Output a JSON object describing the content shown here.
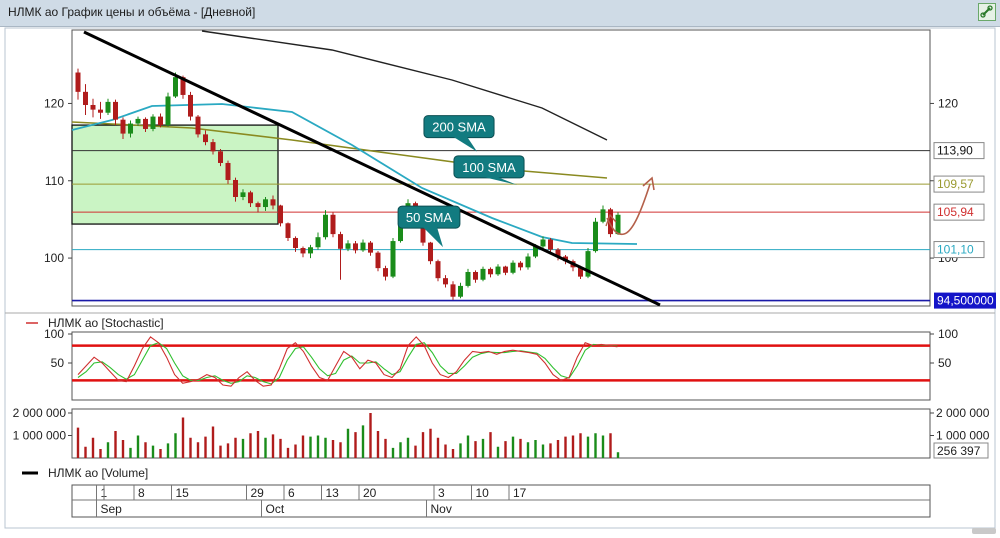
{
  "window": {
    "title": "НЛМК ао График цены и объёма - [Дневной]"
  },
  "colors": {
    "up": "#1a8c1a",
    "down": "#b01c1c",
    "sma50": "#2aa9c2",
    "sma100": "#8a8a20",
    "sma200": "#222222",
    "trend": "#000000",
    "support": "#1a1aa8",
    "resistance": "#d03030",
    "box": "#b8f0b0",
    "callout": "#127b80",
    "arrow": "#b4604a",
    "stoch_k": "#d03030",
    "stoch_d": "#30c030",
    "stoch_band": "#e01010"
  },
  "chart_data": [
    {
      "type": "candlestick",
      "title": "",
      "y_ticks": [
        "120",
        "110",
        "100"
      ],
      "ylim": [
        93.8,
        129.5
      ],
      "price_levels": [
        {
          "label": "113,90",
          "value": 113.9,
          "color": "#333333"
        },
        {
          "label": "109,57",
          "value": 109.57,
          "color": "#9a9a30"
        },
        {
          "label": "105,94",
          "value": 105.94,
          "color": "#d03030"
        },
        {
          "label": "101,10",
          "value": 101.1,
          "color": "#2aa9c2"
        },
        {
          "label": "94,500000",
          "value": 94.5,
          "color": "#1a1aa8",
          "highlight": true
        }
      ],
      "annotations": [
        {
          "text": "200 SMA",
          "x": 50,
          "y": 117
        },
        {
          "text": "100 SMA",
          "x": 54,
          "y": 111.8
        },
        {
          "text": "50 SMA",
          "x": 46,
          "y": 105.3
        }
      ],
      "candles": [
        [
          124,
          124.5,
          120.5,
          121.5
        ],
        [
          121.5,
          122.5,
          118.5,
          119.8
        ],
        [
          119.8,
          120.6,
          118.2,
          119.2
        ],
        [
          119.2,
          120.2,
          118.0,
          118.8
        ],
        [
          118.8,
          120.6,
          118.5,
          120.2
        ],
        [
          120.2,
          120.5,
          117.2,
          117.9
        ],
        [
          117.9,
          118.2,
          115.4,
          116.1
        ],
        [
          116.1,
          117.8,
          115.6,
          117.4
        ],
        [
          117.4,
          118.3,
          117.1,
          118.0
        ],
        [
          118.0,
          118.2,
          116.3,
          116.7
        ],
        [
          116.7,
          118.6,
          116.4,
          118.3
        ],
        [
          118.3,
          118.7,
          116.9,
          117.2
        ],
        [
          117.2,
          121.4,
          117.0,
          120.9
        ],
        [
          120.9,
          124.0,
          120.7,
          123.4
        ],
        [
          123.4,
          123.6,
          120.6,
          121.1
        ],
        [
          121.1,
          121.5,
          117.8,
          118.3
        ],
        [
          118.3,
          118.5,
          115.6,
          116.0
        ],
        [
          116.0,
          116.5,
          114.6,
          115.0
        ],
        [
          115.0,
          115.4,
          113.4,
          113.8
        ],
        [
          113.8,
          114.1,
          111.9,
          112.3
        ],
        [
          112.3,
          112.6,
          109.6,
          110.1
        ],
        [
          110.1,
          110.4,
          107.3,
          107.9
        ],
        [
          107.9,
          108.9,
          107.5,
          108.5
        ],
        [
          108.5,
          108.7,
          106.6,
          107.1
        ],
        [
          107.1,
          107.3,
          105.9,
          106.6
        ],
        [
          106.6,
          107.9,
          106.1,
          107.6
        ],
        [
          107.6,
          108.1,
          106.3,
          106.8
        ],
        [
          106.8,
          106.9,
          104.1,
          104.5
        ],
        [
          104.5,
          104.6,
          102.2,
          102.6
        ],
        [
          102.6,
          102.8,
          100.8,
          101.3
        ],
        [
          101.3,
          101.5,
          100.1,
          100.6
        ],
        [
          100.6,
          101.7,
          100.0,
          101.4
        ],
        [
          101.4,
          103.3,
          101.1,
          102.7
        ],
        [
          102.7,
          106.2,
          102.4,
          105.6
        ],
        [
          105.6,
          105.9,
          102.7,
          103.1
        ],
        [
          103.1,
          103.4,
          97.2,
          101.2
        ],
        [
          101.2,
          102.3,
          100.9,
          101.9
        ],
        [
          101.9,
          102.2,
          100.6,
          101.0
        ],
        [
          101.0,
          102.4,
          100.8,
          102.0
        ],
        [
          102.0,
          102.2,
          100.3,
          100.7
        ],
        [
          100.7,
          100.9,
          98.3,
          98.7
        ],
        [
          98.7,
          99.0,
          97.1,
          97.6
        ],
        [
          97.6,
          102.6,
          97.4,
          102.2
        ],
        [
          102.2,
          106.3,
          102.0,
          105.8
        ],
        [
          105.8,
          107.6,
          105.6,
          107.1
        ],
        [
          107.1,
          107.3,
          105.4,
          105.8
        ],
        [
          105.8,
          105.9,
          101.6,
          102.0
        ],
        [
          102.0,
          102.1,
          99.2,
          99.6
        ],
        [
          99.6,
          99.8,
          97.0,
          97.4
        ],
        [
          97.4,
          97.8,
          96.2,
          96.6
        ],
        [
          96.6,
          97.0,
          94.6,
          95.0
        ],
        [
          95.0,
          96.8,
          94.8,
          96.4
        ],
        [
          96.4,
          98.6,
          96.2,
          98.2
        ],
        [
          98.2,
          98.4,
          96.8,
          97.2
        ],
        [
          97.2,
          98.9,
          97.0,
          98.6
        ],
        [
          98.6,
          98.8,
          97.5,
          97.9
        ],
        [
          97.9,
          99.2,
          97.7,
          98.9
        ],
        [
          98.9,
          99.0,
          97.8,
          98.1
        ],
        [
          98.1,
          99.7,
          97.9,
          99.4
        ],
        [
          99.4,
          99.6,
          98.4,
          98.8
        ],
        [
          98.8,
          100.6,
          98.5,
          100.2
        ],
        [
          100.2,
          101.8,
          100.0,
          101.5
        ],
        [
          101.5,
          102.8,
          101.3,
          102.4
        ],
        [
          102.4,
          102.6,
          100.6,
          101.1
        ],
        [
          101.1,
          101.3,
          99.7,
          100.2
        ],
        [
          100.2,
          100.4,
          99.2,
          99.6
        ],
        [
          99.6,
          99.8,
          98.3,
          98.8
        ],
        [
          98.8,
          99.0,
          97.3,
          97.6
        ],
        [
          97.6,
          101.3,
          97.4,
          100.9
        ],
        [
          100.9,
          105.2,
          100.7,
          104.7
        ],
        [
          104.7,
          106.8,
          104.5,
          106.3
        ],
        [
          106.3,
          106.5,
          102.7,
          103.1
        ],
        [
          103.1,
          105.9,
          103.0,
          105.6
        ]
      ]
    },
    {
      "type": "line",
      "title": "НЛМК ао [Stochastic]",
      "series_label": "НЛМК ао [Stochastic]",
      "y_ticks": [
        "100",
        "50"
      ],
      "ylim": [
        0,
        100
      ],
      "bands": [
        80,
        20
      ],
      "k": [
        30,
        45,
        60,
        50,
        35,
        20,
        18,
        45,
        75,
        95,
        85,
        60,
        30,
        15,
        18,
        22,
        30,
        25,
        12,
        10,
        25,
        35,
        20,
        10,
        12,
        40,
        75,
        85,
        70,
        45,
        25,
        20,
        45,
        70,
        60,
        40,
        55,
        50,
        30,
        25,
        40,
        80,
        95,
        80,
        50,
        30,
        25,
        35,
        55,
        70,
        68,
        70,
        65,
        70,
        72,
        70,
        68,
        65,
        50,
        30,
        20,
        25,
        60,
        85,
        80,
        82,
        80,
        78
      ],
      "d": [
        25,
        35,
        50,
        52,
        42,
        30,
        22,
        30,
        55,
        80,
        85,
        75,
        50,
        28,
        20,
        20,
        25,
        28,
        20,
        15,
        18,
        28,
        25,
        18,
        14,
        25,
        55,
        75,
        78,
        60,
        40,
        28,
        32,
        55,
        62,
        50,
        50,
        52,
        40,
        30,
        35,
        60,
        82,
        85,
        68,
        45,
        32,
        32,
        45,
        60,
        66,
        69,
        68,
        68,
        70,
        71,
        69,
        67,
        58,
        42,
        28,
        24,
        45,
        72,
        82,
        81,
        80,
        79
      ]
    },
    {
      "type": "bar",
      "title": "НЛМК ао [Volume]",
      "series_label": "НЛМК ао [Volume]",
      "y_ticks": [
        "2 000 000",
        "1 000 000"
      ],
      "ylim": [
        0,
        2000000
      ],
      "current_label": "256 397",
      "values": [
        1350000,
        500000,
        900000,
        400000,
        700000,
        1200000,
        800000,
        450000,
        1000000,
        700000,
        550000,
        400000,
        650000,
        1100000,
        1800000,
        900000,
        700000,
        950000,
        1400000,
        550000,
        650000,
        900000,
        850000,
        1100000,
        1200000,
        900000,
        1050000,
        850000,
        450000,
        600000,
        1000000,
        950000,
        1000000,
        900000,
        800000,
        700000,
        1300000,
        1150000,
        1450000,
        2000000,
        1200000,
        850000,
        450000,
        700000,
        900000,
        550000,
        1150000,
        1300000,
        900000,
        600000,
        400000,
        650000,
        1000000,
        750000,
        850000,
        1150000,
        500000,
        750000,
        950000,
        850000,
        700000,
        800000,
        600000,
        650000,
        800000,
        950000,
        1000000,
        1100000,
        950000,
        1100000,
        1000000,
        1100000,
        256397
      ]
    }
  ],
  "x_axis": {
    "day_labels": [
      {
        "label": "1",
        "index": 3
      },
      {
        "label": "8",
        "index": 8
      },
      {
        "label": "15",
        "index": 13
      },
      {
        "label": "29",
        "index": 23
      },
      {
        "label": "6",
        "index": 28
      },
      {
        "label": "13",
        "index": 33
      },
      {
        "label": "20",
        "index": 38
      },
      {
        "label": "3",
        "index": 48
      },
      {
        "label": "10",
        "index": 53
      },
      {
        "label": "17",
        "index": 58
      }
    ],
    "month_labels": [
      {
        "label": "Sep",
        "index": 3
      },
      {
        "label": "Oct",
        "index": 25
      },
      {
        "label": "Nov",
        "index": 47
      }
    ]
  }
}
